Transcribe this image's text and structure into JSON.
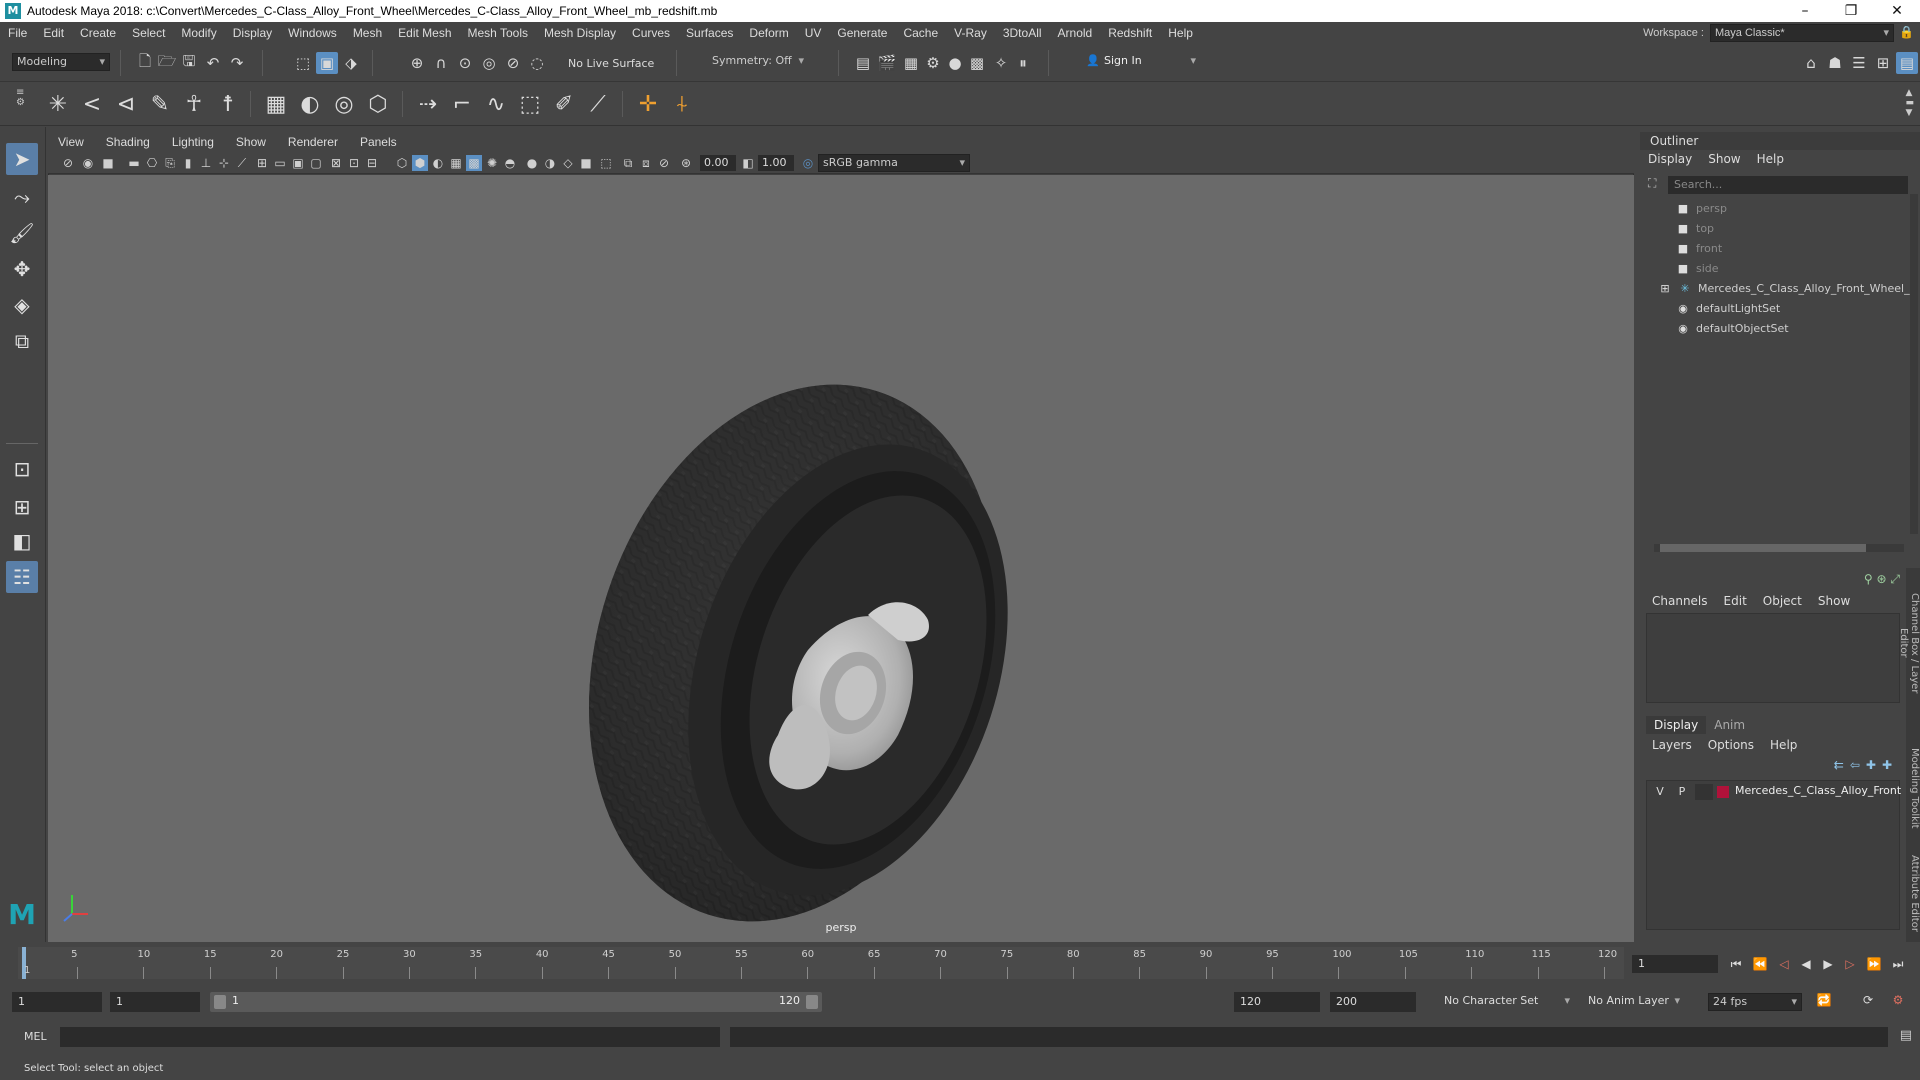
{
  "window": {
    "title": "Autodesk Maya 2018: c:\\Convert\\Mercedes_C-Class_Alloy_Front_Wheel\\Mercedes_C-Class_Alloy_Front_Wheel_mb_redshift.mb",
    "logo": "M"
  },
  "menubar": {
    "items": [
      "File",
      "Edit",
      "Create",
      "Select",
      "Modify",
      "Display",
      "Windows",
      "Mesh",
      "Edit Mesh",
      "Mesh Tools",
      "Mesh Display",
      "Curves",
      "Surfaces",
      "Deform",
      "UV",
      "Generate",
      "Cache",
      "V-Ray",
      "3DtoAll",
      "Arnold",
      "Redshift",
      "Help"
    ],
    "workspace_label": "Workspace :",
    "workspace_value": "Maya Classic*"
  },
  "statusline": {
    "mode": "Modeling",
    "live_surface": "No Live Surface",
    "symmetry": "Symmetry: Off",
    "sign_in": "Sign In"
  },
  "viewport": {
    "menu": [
      "View",
      "Shading",
      "Lighting",
      "Show",
      "Renderer",
      "Panels"
    ],
    "exposure": "0.00",
    "gamma": "1.00",
    "color_space": "sRGB gamma",
    "camera_label": "persp"
  },
  "outliner": {
    "title": "Outliner",
    "menu": [
      "Display",
      "Show",
      "Help"
    ],
    "search_placeholder": "Search...",
    "items": [
      {
        "label": "persp",
        "icon": "camera-icon",
        "dim": true
      },
      {
        "label": "top",
        "icon": "camera-icon",
        "dim": true
      },
      {
        "label": "front",
        "icon": "camera-icon",
        "dim": true
      },
      {
        "label": "side",
        "icon": "camera-icon",
        "dim": true
      },
      {
        "label": "Mercedes_C_Class_Alloy_Front_Wheel_n",
        "icon": "group-icon",
        "dim": false
      },
      {
        "label": "defaultLightSet",
        "icon": "set-icon",
        "dim": false
      },
      {
        "label": "defaultObjectSet",
        "icon": "set-icon",
        "dim": false
      }
    ]
  },
  "channelbox": {
    "menu": [
      "Channels",
      "Edit",
      "Object",
      "Show"
    ]
  },
  "layereditor": {
    "tabs": [
      "Display",
      "Anim"
    ],
    "menu": [
      "Layers",
      "Options",
      "Help"
    ],
    "layer": {
      "v": "V",
      "p": "P",
      "name": "Mercedes_C_Class_Alloy_Front",
      "color": "#b0123a"
    }
  },
  "sidetabs": [
    "Channel Box / Layer Editor",
    "Modeling Toolkit",
    "Attribute Editor"
  ],
  "timeline": {
    "ticks": [
      "5",
      "10",
      "15",
      "20",
      "25",
      "30",
      "35",
      "40",
      "45",
      "50",
      "55",
      "60",
      "65",
      "70",
      "75",
      "80",
      "85",
      "90",
      "95",
      "100",
      "105",
      "110",
      "115",
      "120"
    ],
    "start_tick": "1",
    "current_frame": "1"
  },
  "range": {
    "start": "1",
    "playback_start": "1",
    "slider_start": "1",
    "slider_end": "120",
    "playback_end": "120",
    "end": "200",
    "character_set": "No Character Set",
    "anim_layer": "No Anim Layer",
    "fps": "24 fps"
  },
  "cmdline": {
    "label": "MEL"
  },
  "helpline": {
    "text": "Select Tool: select an object"
  },
  "colors": {
    "accent": "#5b8fc2",
    "layer_color": "#b0123a"
  }
}
